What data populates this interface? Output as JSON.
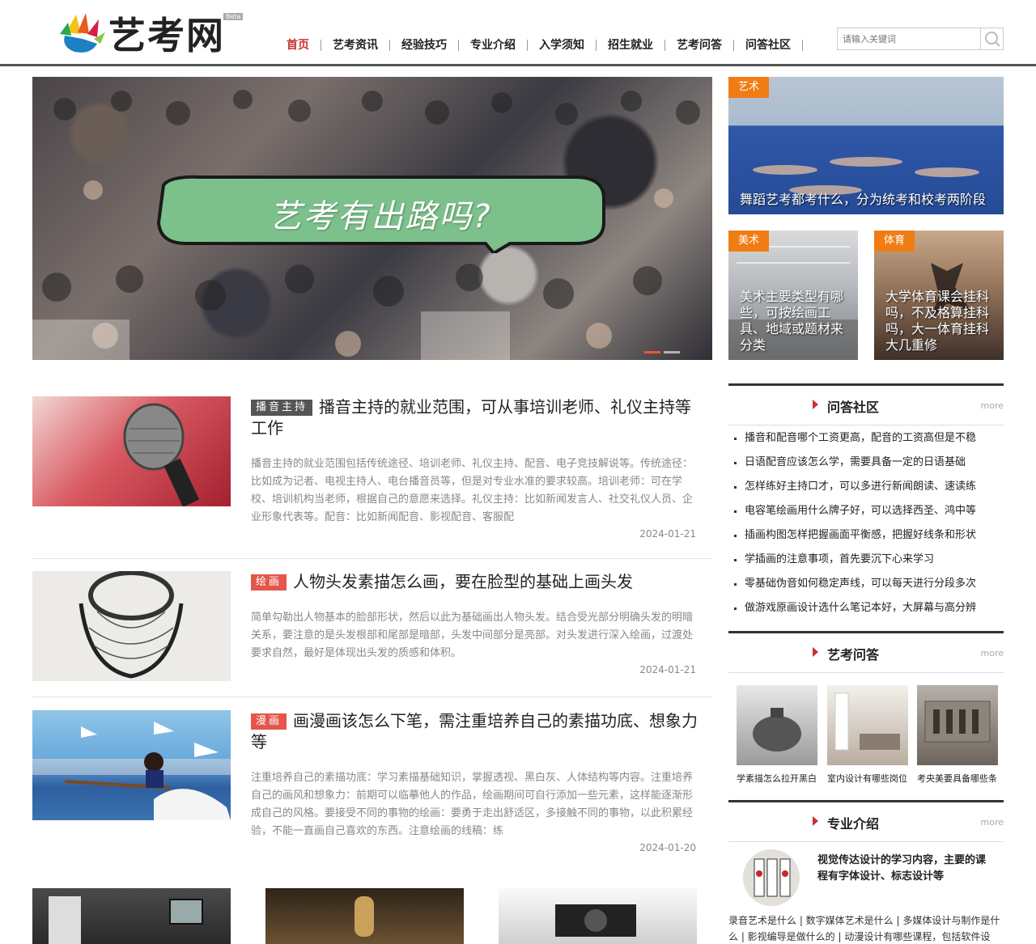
{
  "site": {
    "logo_text": "艺考网",
    "beta": "Beta"
  },
  "nav": [
    {
      "label": "首页",
      "active": true
    },
    {
      "label": "艺考资讯"
    },
    {
      "label": "经验技巧"
    },
    {
      "label": "专业介绍"
    },
    {
      "label": "入学须知"
    },
    {
      "label": "招生就业"
    },
    {
      "label": "艺考问答"
    },
    {
      "label": "问答社区"
    }
  ],
  "search": {
    "placeholder": "请输入关键词"
  },
  "hero": {
    "text": "艺考有出路吗?"
  },
  "cards": [
    {
      "tag": "艺术",
      "caption": "舞蹈艺考都考什么，分为统考和校考两阶段"
    },
    {
      "tag": "美术",
      "caption": "美术主要类型有哪些，可按绘画工具、地域或题材来分类"
    },
    {
      "tag": "体育",
      "caption": "大学体育课会挂科吗，不及格算挂科吗，大一体育挂科大几重修"
    }
  ],
  "articles": [
    {
      "tag": "播音主持",
      "title": "播音主持的就业范围，可从事培训老师、礼仪主持等工作",
      "desc": "播音主持的就业范围包括传统途径、培训老师、礼仪主持、配音、电子竞技解说等。传统途径：比如成为记者、电视主持人、电台播音员等，但是对专业水准的要求较高。培训老师：可在学校、培训机构当老师，根据自己的意愿来选择。礼仪主持：比如新闻发言人、社交礼仪人员、企业形象代表等。配音：比如新闻配音、影视配音、客服配",
      "date": "2024-01-21"
    },
    {
      "tag": "绘画",
      "title": "人物头发素描怎么画，要在脸型的基础上画头发",
      "desc": "简单勾勒出人物基本的脸部形状，然后以此为基础画出人物头发。结合受光部分明确头发的明暗关系，要注意的是头发根部和尾部是暗部，头发中间部分是亮部。对头发进行深入绘画，过渡处要求自然，最好是体现出头发的质感和体积。",
      "date": "2024-01-21"
    },
    {
      "tag": "漫画",
      "title": "画漫画该怎么下笔，需注重培养自己的素描功底、想象力等",
      "desc": "注重培养自己的素描功底：学习素描基础知识，掌握透视、黑白灰、人体结构等内容。注重培养自己的画风和想象力：前期可以临摹他人的作品，绘画期间可自行添加一些元素，这样能逐渐形成自己的风格。要接受不同的事物的绘画：要勇于走出舒适区，多接触不同的事物，以此积累经验，不能一直画自己喜欢的东西。注意绘画的线稿：练",
      "date": "2024-01-20"
    }
  ],
  "sidebar": {
    "qa": {
      "title": "问答社区",
      "more": "more",
      "items": [
        "播音和配音哪个工资更高，配音的工资高但是不稳",
        "日语配音应该怎么学，需要具备一定的日语基础",
        "怎样练好主持口才，可以多进行新闻朗读、速读练",
        "电容笔绘画用什么牌子好，可以选择西圣、鸿中等",
        "插画构图怎样把握画面平衡感，把握好线条和形状",
        "学插画的注意事项，首先要沉下心来学习",
        "零基础伪音如何稳定声线，可以每天进行分段多次",
        "做游戏原画设计选什么笔记本好，大屏幕与高分辨"
      ]
    },
    "ask": {
      "title": "艺考问答",
      "more": "more",
      "items": [
        "学素描怎么拉开黑白",
        "室内设计有哪些岗位",
        "考央美要具备哪些条"
      ]
    },
    "major": {
      "title": "专业介绍",
      "more": "more",
      "feature": "视觉传达设计的学习内容，主要的课程有字体设计、标志设计等",
      "links": "录音艺术是什么 | 数字媒体艺术是什么 | 多媒体设计与制作是什么 | 影视编导是做什么的 | 动漫设计有哪些课程，包括软件设"
    }
  },
  "colors": {
    "accent_red": "#c8312e",
    "tag_orange": "#f07d14",
    "bubble_green": "#7cc08b"
  }
}
